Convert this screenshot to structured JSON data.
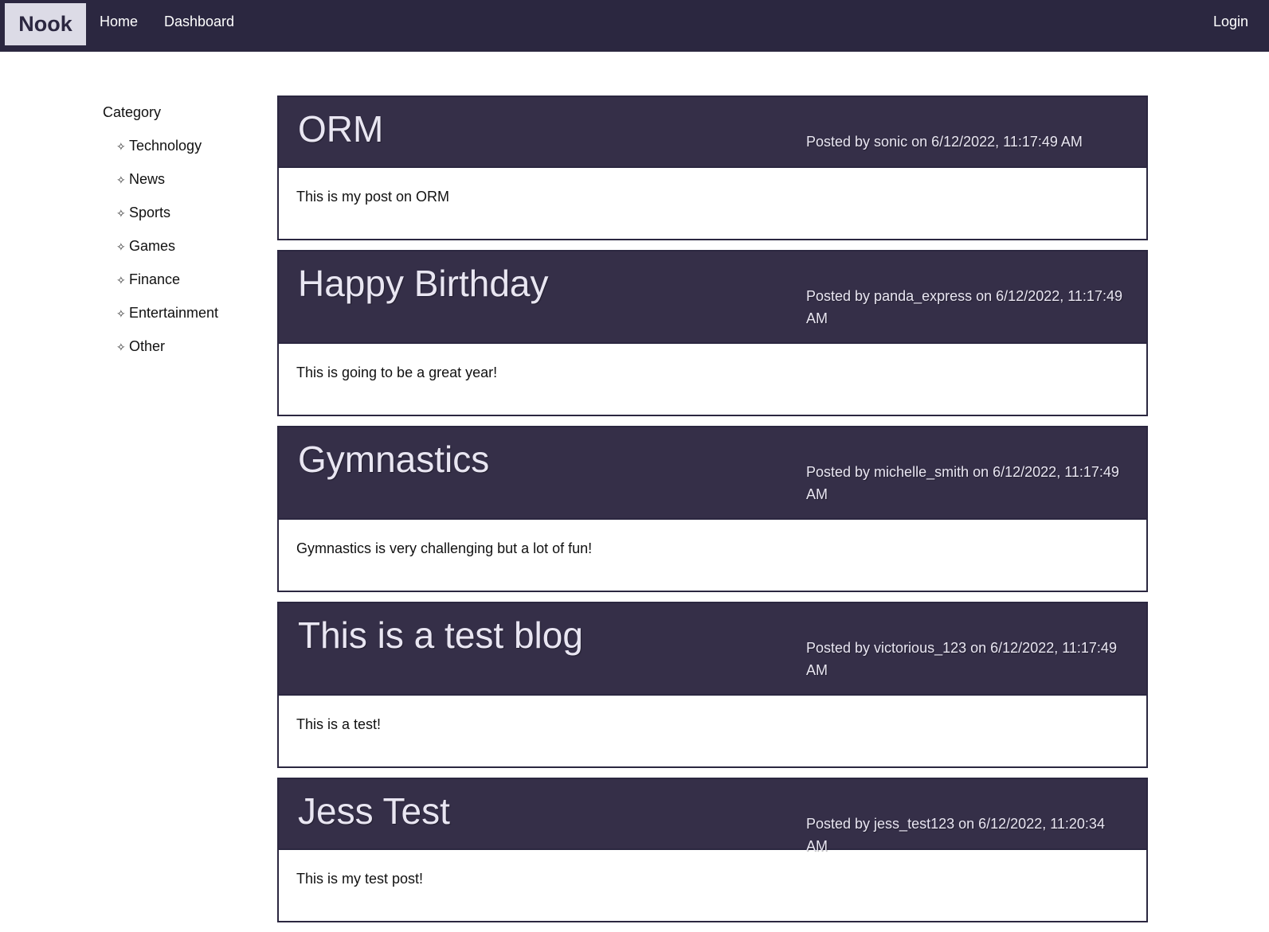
{
  "navbar": {
    "brand": "Nook",
    "links": {
      "home": "Home",
      "dashboard": "Dashboard",
      "login": "Login"
    }
  },
  "sidebar": {
    "title": "Category",
    "icon": "sparkle-icon",
    "items": [
      "Technology",
      "News",
      "Sports",
      "Games",
      "Finance",
      "Entertainment",
      "Other"
    ]
  },
  "posts": [
    {
      "title": "ORM",
      "meta": "Posted by sonic on 6/12/2022, 11:17:49 AM",
      "body": "This is my post on ORM"
    },
    {
      "title": "Happy Birthday",
      "meta": "Posted by panda_express on 6/12/2022, 11:17:49 AM",
      "body": "This is going to be a great year!"
    },
    {
      "title": "Gymnastics",
      "meta": "Posted by michelle_smith on 6/12/2022, 11:17:49 AM",
      "body": "Gymnastics is very challenging but a lot of fun!"
    },
    {
      "title": "This is a test blog",
      "meta": "Posted by victorious_123 on 6/12/2022, 11:17:49 AM",
      "body": "This is a test!"
    },
    {
      "title": "Jess Test",
      "meta": "Posted by jess_test123 on 6/12/2022, 11:20:34 AM",
      "body": "This is my test post!"
    }
  ],
  "colors": {
    "navbar": "#2b2740",
    "post_header": "#352f48",
    "brand_bg": "#dcdbe6",
    "header_text": "#e9e6f2"
  }
}
